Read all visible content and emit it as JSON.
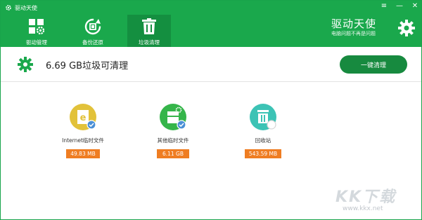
{
  "window": {
    "title": "驱动天使",
    "controls": {
      "menu": "≡",
      "minimize": "—",
      "close": "✕"
    }
  },
  "nav": {
    "tabs": [
      {
        "label": "驱动管理",
        "icon": "grid-gear-icon"
      },
      {
        "label": "备份还原",
        "icon": "backup-restore-icon"
      },
      {
        "label": "垃圾清理",
        "icon": "trash-icon",
        "active": true
      }
    ]
  },
  "brand": {
    "name": "驱动天使",
    "slogan": "电脑问题不再是问题"
  },
  "summary": {
    "text": "6.69 GB垃圾可清理",
    "button": "一键清理"
  },
  "items": [
    {
      "name": "Internet临时文件",
      "size": "49.83 MB",
      "icon": "internet-files-icon",
      "color": "#e2c23a",
      "checked": true
    },
    {
      "name": "其他临时文件",
      "size": "6.11 GB",
      "icon": "temp-files-icon",
      "color": "#35b54a",
      "checked": true
    },
    {
      "name": "回收站",
      "size": "543.59 MB",
      "icon": "recycle-bin-icon",
      "color": "#3cc3b5",
      "checked": false
    }
  ],
  "watermark": {
    "text": "KK下载",
    "url": "www.kkx.net"
  },
  "colors": {
    "primary": "#1aa84c",
    "button": "#178a3f",
    "badge": "#ef7d22",
    "check": "#4a8fd6"
  }
}
